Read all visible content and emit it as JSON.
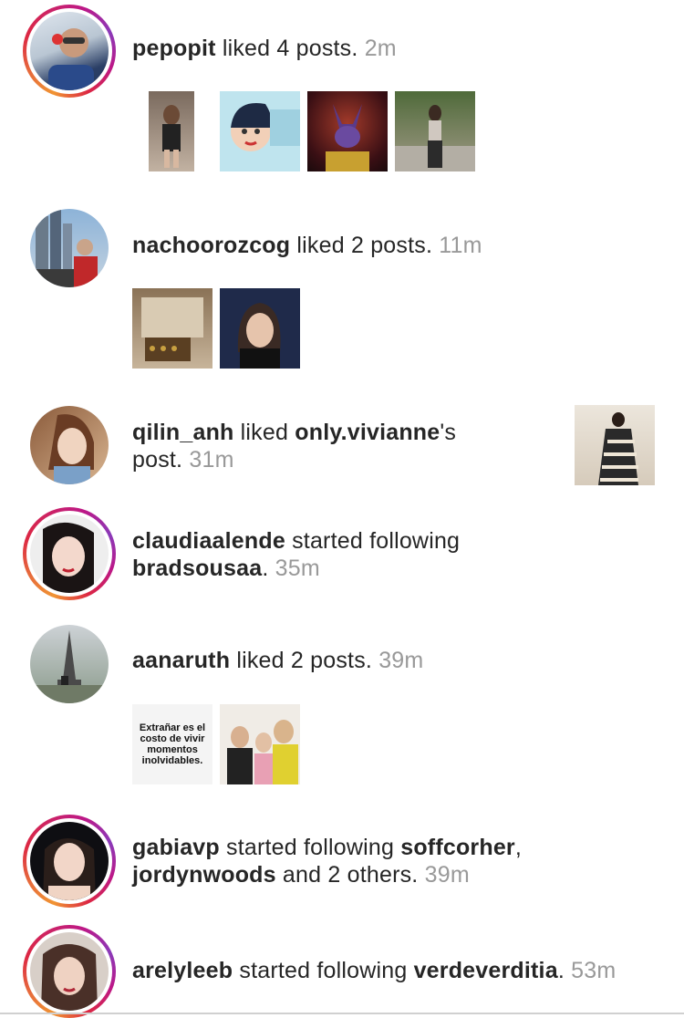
{
  "notifications": [
    {
      "user": "pepopit",
      "action": " liked 4 posts.",
      "time": "2m",
      "thumbs": [
        "photo",
        "illustration",
        "character",
        "photo"
      ]
    },
    {
      "user": "nachoorozcog",
      "action": " liked 2 posts.",
      "time": "11m",
      "thumbs": [
        "photo",
        "photo"
      ]
    },
    {
      "user": "qilin_anh",
      "action": " liked ",
      "target": "only.vivianne",
      "action_tail": "'s",
      "action2": "post.",
      "time": "31m"
    },
    {
      "user": "claudiaalende",
      "action": " started following",
      "target": "bradsousaa",
      "action_tail": ".",
      "time": "35m"
    },
    {
      "user": "aanaruth",
      "action": " liked 2 posts.",
      "time": "39m",
      "quote": "Extrañar es el costo de vivir momentos inolvidables."
    },
    {
      "user": "gabiavp",
      "action": " started following ",
      "target": "soffcorher",
      "action_tail": ",",
      "target2": "jordynwoods",
      "action2": " and 2 others.",
      "time": "39m"
    },
    {
      "user": "arelyleeb",
      "action": " started following ",
      "target": "verdeverditia",
      "action_tail": ".",
      "time": "53m"
    }
  ]
}
